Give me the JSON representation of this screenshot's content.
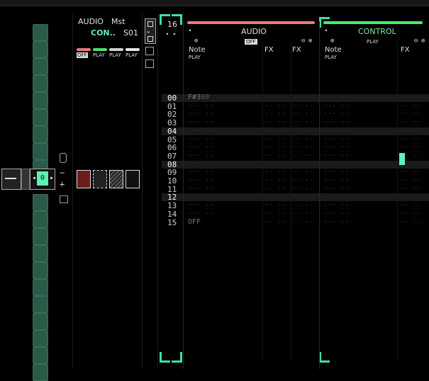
{
  "top": {
    "audio_label": "AUDIO",
    "mst_label": "Mst",
    "con_label": "CON..",
    "s01_label": "S01"
  },
  "mixer": {
    "chips": [
      "OFF",
      "PLAY",
      "PLAY",
      "PLAY"
    ],
    "chip_colors": [
      "#e87a7a",
      "#4ee06e",
      "#d0d0d0",
      "#e6e6e6"
    ],
    "transport_value": "0"
  },
  "pattern": {
    "length": "16"
  },
  "tracks": [
    {
      "name": "AUDIO",
      "color": "#f07878",
      "status": "OFF",
      "col_note": "Note",
      "col_sub": "PLAY",
      "col_fx1": "FX",
      "col_fx2": "FX"
    },
    {
      "name": "CONTROL",
      "color": "#44ee66",
      "status": "PLAY",
      "col_note": "Note",
      "col_sub": "PLAY",
      "col_fx1": "FX"
    }
  ],
  "rows": [
    "00",
    "01",
    "02",
    "03",
    "04",
    "05",
    "06",
    "07",
    "08",
    "09",
    "10",
    "11",
    "12",
    "13",
    "14",
    "15"
  ],
  "notes": {
    "row0": "F#3",
    "row0_vol": "00",
    "row15": "OFF"
  },
  "colors": {
    "accent": "#3de0a8",
    "pad": "#2c5a48"
  }
}
